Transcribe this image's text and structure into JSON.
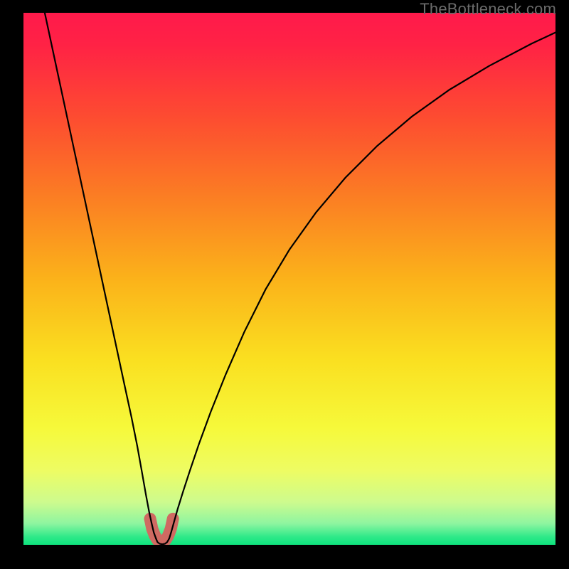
{
  "watermark": "TheBottleneck.com",
  "chart_data": {
    "type": "line",
    "title": "",
    "xlabel": "",
    "ylabel": "",
    "xlim": [
      0,
      100
    ],
    "ylim": [
      0,
      100
    ],
    "grid": false,
    "legend": false,
    "gradient_stops": [
      {
        "offset": 0.0,
        "color": "#ff1a4b"
      },
      {
        "offset": 0.06,
        "color": "#ff2245"
      },
      {
        "offset": 0.2,
        "color": "#fd4d30"
      },
      {
        "offset": 0.35,
        "color": "#fb7f23"
      },
      {
        "offset": 0.5,
        "color": "#fbb21a"
      },
      {
        "offset": 0.65,
        "color": "#fadf20"
      },
      {
        "offset": 0.78,
        "color": "#f6f93a"
      },
      {
        "offset": 0.86,
        "color": "#eefc63"
      },
      {
        "offset": 0.92,
        "color": "#cdfb8e"
      },
      {
        "offset": 0.96,
        "color": "#8ef5a0"
      },
      {
        "offset": 0.985,
        "color": "#2fe989"
      },
      {
        "offset": 1.0,
        "color": "#0ee37e"
      }
    ],
    "series": [
      {
        "name": "left_curve",
        "x": [
          4.0,
          5.5,
          7.0,
          8.5,
          10.0,
          11.5,
          13.0,
          14.5,
          16.0,
          17.5,
          19.0,
          20.3,
          21.4,
          22.3,
          23.0,
          23.6,
          24.1,
          24.5,
          24.9
        ],
        "y": [
          100.0,
          93.0,
          86.0,
          79.0,
          72.0,
          65.0,
          58.0,
          51.0,
          44.0,
          37.0,
          30.0,
          24.0,
          18.5,
          13.5,
          9.5,
          6.3,
          4.0,
          2.3,
          1.2
        ]
      },
      {
        "name": "right_curve",
        "x": [
          27.4,
          27.8,
          28.3,
          29.0,
          30.0,
          31.3,
          33.0,
          35.2,
          38.0,
          41.5,
          45.5,
          50.0,
          55.0,
          60.5,
          66.5,
          73.0,
          80.0,
          87.5,
          95.5,
          100.0
        ],
        "y": [
          1.2,
          2.5,
          4.3,
          6.8,
          10.0,
          14.0,
          19.0,
          25.0,
          32.0,
          40.0,
          48.0,
          55.5,
          62.5,
          69.0,
          75.0,
          80.5,
          85.5,
          90.0,
          94.2,
          96.3
        ]
      },
      {
        "name": "valley_link",
        "x": [
          24.9,
          25.2,
          25.6,
          26.1,
          26.6,
          27.0,
          27.4
        ],
        "y": [
          1.2,
          0.5,
          0.2,
          0.1,
          0.2,
          0.5,
          1.2
        ]
      }
    ],
    "valley_marker": {
      "x": [
        23.8,
        24.2,
        24.7,
        25.2,
        25.7,
        26.2,
        26.7,
        27.2,
        27.7,
        28.1
      ],
      "y": [
        4.9,
        3.0,
        1.7,
        0.9,
        0.6,
        0.6,
        0.9,
        1.7,
        3.0,
        4.9
      ],
      "color": "#cf6a62",
      "stroke_width_px": 17
    }
  }
}
